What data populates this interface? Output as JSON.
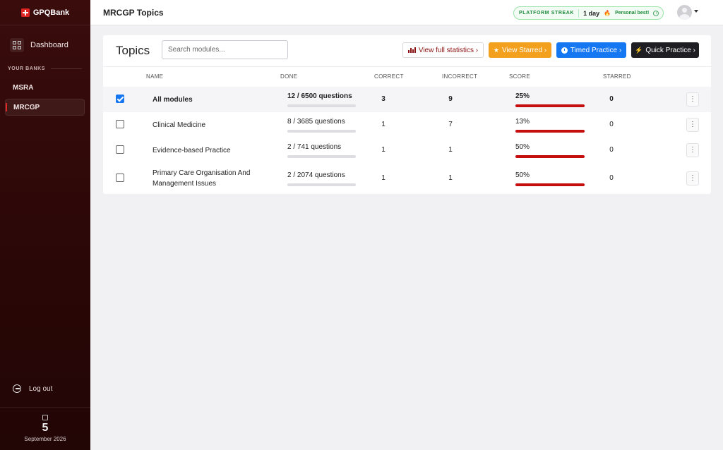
{
  "brand": {
    "name": "GPQBank"
  },
  "sidebar": {
    "dashboard_label": "Dashboard",
    "banks_heading": "YOUR BANKS",
    "banks": [
      {
        "label": "MSRA"
      },
      {
        "label": "MRCGP",
        "active": true
      }
    ],
    "logout_label": "Log out",
    "date": {
      "day": "5",
      "month_year": "September 2026"
    }
  },
  "topbar": {
    "title": "MRCGP Topics",
    "streak": {
      "label": "PLATFORM STREAK",
      "days": "1 day",
      "best": "Personal best!"
    }
  },
  "topics": {
    "title": "Topics",
    "search_placeholder": "Search modules...",
    "buttons": {
      "stats": "View full statistics ›",
      "starred": "View Starred ›",
      "timed": "Timed Practice ›",
      "quick": "Quick Practice ›"
    },
    "columns": {
      "name": "NAME",
      "done": "DONE",
      "correct": "CORRECT",
      "incorrect": "INCORRECT",
      "score": "SCORE",
      "starred": "STARRED"
    },
    "rows": [
      {
        "name": "All modules",
        "done": "12 / 6500 questions",
        "done_fraction": 0.0018,
        "correct": "3",
        "incorrect": "9",
        "score": "25%",
        "score_fraction": 0.25,
        "starred": "0",
        "checked": true
      },
      {
        "name": "Clinical Medicine",
        "done": "8 / 3685 questions",
        "done_fraction": 0.0022,
        "correct": "1",
        "incorrect": "7",
        "score": "13%",
        "score_fraction": 0.13,
        "starred": "0",
        "checked": false
      },
      {
        "name": "Evidence-based Practice",
        "done": "2 / 741 questions",
        "done_fraction": 0.0027,
        "correct": "1",
        "incorrect": "1",
        "score": "50%",
        "score_fraction": 0.5,
        "starred": "0",
        "checked": false
      },
      {
        "name": "Primary Care Organisation And Management Issues",
        "done": "2 / 2074 questions",
        "done_fraction": 0.001,
        "correct": "1",
        "incorrect": "1",
        "score": "50%",
        "score_fraction": 0.5,
        "starred": "0",
        "checked": false
      }
    ]
  },
  "colors": {
    "brand_red": "#e02424",
    "score_green": "#2fd43a",
    "score_red": "#c50f0f",
    "starred_orange": "#f2a01e",
    "timed_blue": "#1677f2",
    "quick_dark": "#1f1f23"
  },
  "icons": {
    "brand": "plus-cross-icon",
    "dashboard": "grid-icon",
    "logout": "logout-icon",
    "calendar": "calendar-icon",
    "stats": "bar-chart-icon",
    "starred": "star-icon",
    "timed": "clock-icon",
    "quick": "bolt-icon",
    "row_menu": "kebab-icon"
  }
}
